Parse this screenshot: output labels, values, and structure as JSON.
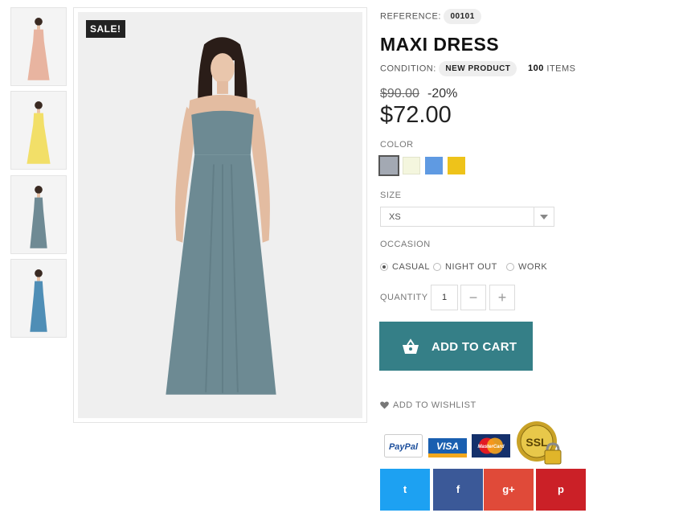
{
  "thumbnails": [
    {
      "color": "#e8b4a0"
    },
    {
      "color": "#f2df68"
    },
    {
      "color": "#6f8a94"
    },
    {
      "color": "#4f8eb6"
    }
  ],
  "main_image": {
    "sale_badge": "SALE!",
    "dress_color": "#6d8a93"
  },
  "product": {
    "reference_label": "REFERENCE:",
    "reference_value": "00101",
    "title": "MAXI DRESS",
    "condition_label": "CONDITION:",
    "condition_value": "NEW PRODUCT",
    "items_count": "100",
    "items_label": "ITEMS",
    "old_price": "$90.00",
    "discount": "-20%",
    "price": "$72.00"
  },
  "color": {
    "label": "COLOR",
    "swatches": [
      {
        "hex": "#a3a9b3",
        "selected": true
      },
      {
        "hex": "#f4f6de",
        "selected": false
      },
      {
        "hex": "#5f9ae2",
        "selected": false
      },
      {
        "hex": "#eec31a",
        "selected": false
      }
    ]
  },
  "size": {
    "label": "SIZE",
    "selected": "XS"
  },
  "occasion": {
    "label": "OCCASION",
    "options": [
      "CASUAL",
      "NIGHT OUT",
      "WORK"
    ],
    "selected": "CASUAL"
  },
  "quantity": {
    "label": "QUANTITY",
    "value": "1",
    "minus": "−",
    "plus": "+"
  },
  "cart": {
    "label": "ADD TO CART",
    "color": "#357f87"
  },
  "wishlist": {
    "label": "ADD TO WISHLIST"
  },
  "payments": {
    "paypal": "PayPal",
    "visa": "VISA",
    "mastercard": "MasterCard",
    "ssl": "SSL"
  },
  "social": [
    {
      "icon": "twitter-icon",
      "glyph": "t",
      "color": "#1da1f2"
    },
    {
      "icon": "facebook-icon",
      "glyph": "f",
      "color": "#3b5998"
    },
    {
      "icon": "google-plus-icon",
      "glyph": "g+",
      "color": "#e04a39"
    },
    {
      "icon": "pinterest-icon",
      "glyph": "p",
      "color": "#cb2027"
    }
  ]
}
